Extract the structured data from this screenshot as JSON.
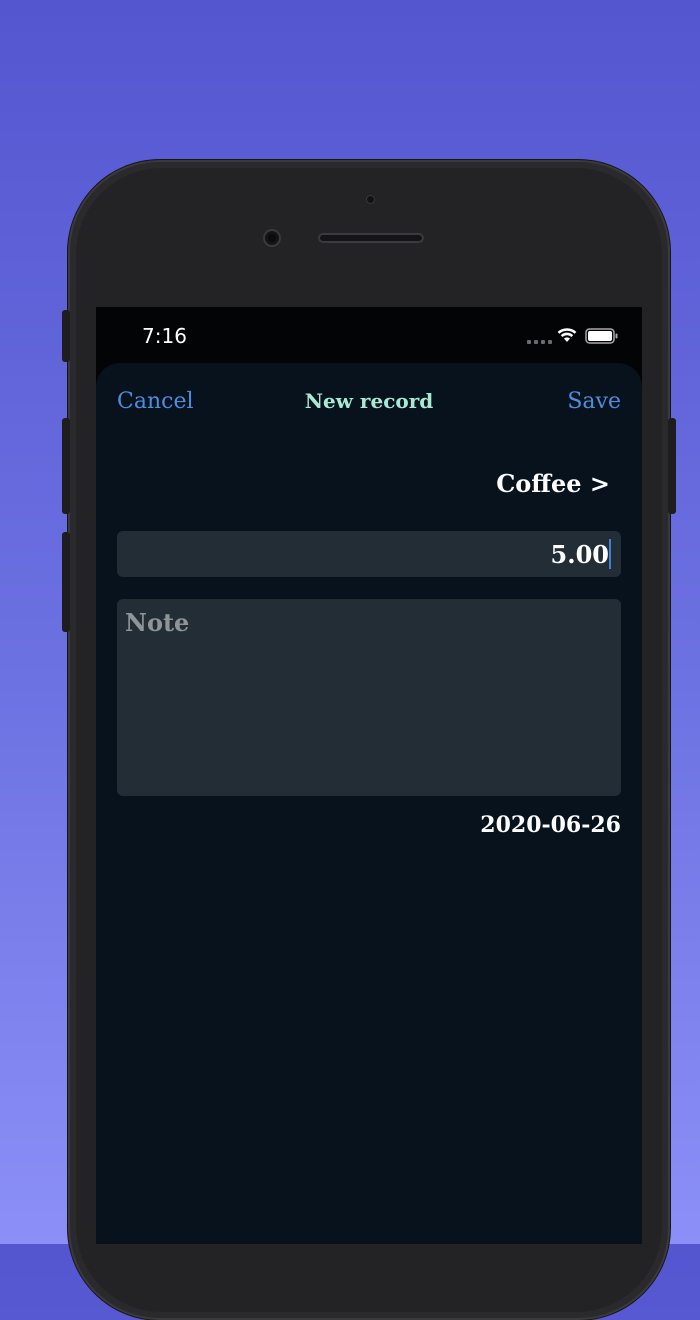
{
  "status_bar": {
    "time": "7:16",
    "icons": [
      "cellular-signal-icon",
      "wifi-icon",
      "battery-icon"
    ]
  },
  "nav": {
    "cancel_label": "Cancel",
    "title": "New record",
    "save_label": "Save"
  },
  "form": {
    "category": "Coffee >",
    "amount": "5.00",
    "note_placeholder": "Note",
    "date": "2020-06-26"
  },
  "colors": {
    "accent": "#4a8ee0",
    "title": "#a6ead4",
    "sheet_background": "#07121d",
    "field_background": "#222d36",
    "backdrop_top": "#5456d0",
    "backdrop_bottom": "#8b8ff7"
  }
}
